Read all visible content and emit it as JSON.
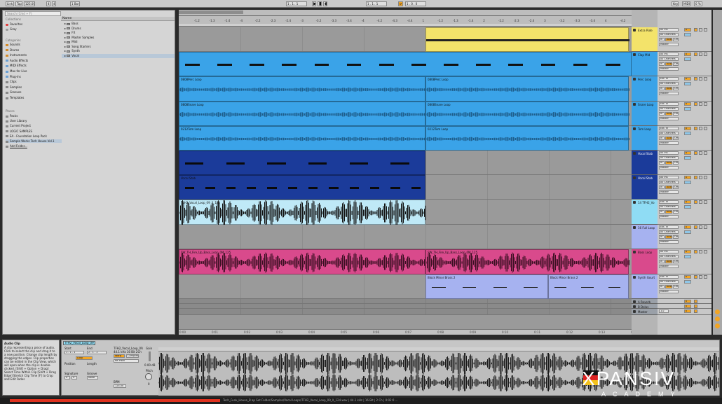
{
  "topbar": {
    "link": "Link",
    "tap": "Tap",
    "tempo": "125.00",
    "meter_num": "4",
    "meter_den": "4",
    "quant": "1 Bar",
    "position": "1 . 1 . 1",
    "loop_start": "1 . 1 . 1",
    "loop_len": "1 . 0 . 0",
    "key": "Key",
    "midi": "MIDI",
    "cpu": "0 %",
    "dots": "..."
  },
  "browser": {
    "search_placeholder": "Search (Cmd + F)",
    "collections_label": "Collections",
    "collections": [
      {
        "label": "Favorites",
        "color": "#e03a3a"
      },
      {
        "label": "Gray",
        "color": "#9a9a9a"
      }
    ],
    "categories_label": "Categories",
    "categories": [
      "Sounds",
      "Drums",
      "Instruments",
      "Audio Effects",
      "MIDI Effects",
      "Max for Live",
      "Plug-ins",
      "Clips",
      "Samples",
      "Grooves",
      "Templates"
    ],
    "places_label": "Places",
    "places": [
      "Packs",
      "User Library",
      "Current Project",
      "LOGIC SAMPLES",
      "EA - Foundation Loop Pack",
      "Sample Works Tech House Vol.1",
      "Add Folder..."
    ],
    "name_header": "Name",
    "items": [
      "Bass",
      "Drums",
      "FX",
      "Master Samples",
      "Midi",
      "Song Starters",
      "Synth",
      "Vocal"
    ]
  },
  "ruler": {
    "top": [
      "-1.2",
      "-1.3",
      "-1.4",
      "-4",
      "-2.2",
      "-2.3",
      "-2.4",
      "-3",
      "-3.2",
      "-3.3",
      "-3.4",
      "-4",
      "-4.2",
      "-4.3",
      "-4.4",
      "1",
      "-1.2",
      "-1.3",
      "-1.4",
      "2",
      "-2.2",
      "-2.3",
      "-2.4",
      "3",
      "-3.2",
      "-3.3",
      "-3.4",
      "4",
      "-4.2",
      "-4.3",
      "-4.4"
    ],
    "bottom": [
      "0:00",
      "0:01",
      "0:02",
      "0:03",
      "0:04",
      "0:05",
      "0:06",
      "0:07",
      "0:08",
      "0:09",
      "0:10",
      "0:11",
      "0:12",
      "0:13",
      "0:14"
    ]
  },
  "clips": {
    "perc": "0808Perc Loop",
    "snare": "0808Snare Loop",
    "tom": "0212Tom Loop",
    "vocal_stab": "Vocal Stab",
    "vocal_loop": "TFH2_Vocal_Loop_09_X_124",
    "bass_loop": "SW_TH_Fire_Up_Bass_Loop_0M_125",
    "brass": "Block Minor Brass 2"
  },
  "tracks": [
    {
      "label": "Extra Ride",
      "color": "#f3e36a"
    },
    {
      "label": "Clap Mid",
      "color": "#3aa3e8"
    },
    {
      "label": "Perc Loop",
      "color": "#3aa3e8"
    },
    {
      "label": "Snare Loop",
      "color": "#3aa3e8"
    },
    {
      "label": "Tom Loop",
      "color": "#3aa3e8"
    },
    {
      "label": "Vocal Stab",
      "color": "#1b3b9a"
    },
    {
      "label": "Vocal Stab",
      "color": "#1b3b9a"
    },
    {
      "label": "14 TFH2_Vo",
      "color": "#8fdcf4"
    },
    {
      "label": "16 Full Loop",
      "color": "#a6b2f0"
    },
    {
      "label": "Bass Loop",
      "color": "#d94a8c"
    },
    {
      "label": "Synth Gourt",
      "color": "#a6b2f0"
    },
    {
      "label": "A Reverb",
      "color": "#9aa0a8"
    },
    {
      "label": "B Delay",
      "color": "#9aa0a8"
    },
    {
      "label": "Master",
      "color": "#9aa0a8"
    }
  ],
  "mixer": {
    "input": "All Ins",
    "ext": "Ext. In",
    "channel": "All Channels",
    "monitor_in": "In",
    "monitor_auto": "Auto",
    "monitor_off": "Off",
    "out": "Master",
    "vol": "0",
    "send": "-inf",
    "fraction": "1/2"
  },
  "info": {
    "title": "Audio Clip",
    "body": "A clip representing a piece of audio. Click to select the clip and drag it to a new position. Change clip length by dragging the edges. Clip properties can be edited in the Clip View, which will open when the clip is double-clicked. [Shift + Option + Drag] Select Time Within Clip [Shift + Drag Edge] Stretch Clip Time [F] to Crop and Edit Fades"
  },
  "clipview": {
    "name": "TFH2_Vocal_Loop_09_X_124",
    "start_label": "Start",
    "end_label": "End",
    "loop_label": "Loop",
    "position_label": "Position",
    "length_label": "Length",
    "signature_label": "Signature",
    "groove_label": "Groove",
    "none": "None",
    "file": "TFH2_Vocal_Loop_09_X_124.wav",
    "khz": "44.1 kHz 16 Bit 2Ch",
    "warp": "Warp",
    "complex": "Complex",
    "pitch": "Re-Pitch",
    "bpm_label": "BPM",
    "bpm": "124.00",
    "gain_label": "Gain",
    "gain": "0.00 dB",
    "pitch_label": "Pitch",
    "pitch_val": "0",
    "start": "1 . 1 . 1",
    "end": "2 . 1 . 1",
    "sig_num": "4",
    "sig_den": "4"
  },
  "statusbar": {
    "text": "Tech_Funk_House_B ap Set Folder/Samples/Vocal Loops/TFH2_Vocal_Loop_09_X_124.wav | 44.1 kHz | 16 Bit | 2 Ch | 0:02:0 ..."
  },
  "brand": {
    "name": "XPANSIV",
    "sub": "ACADEMY"
  }
}
